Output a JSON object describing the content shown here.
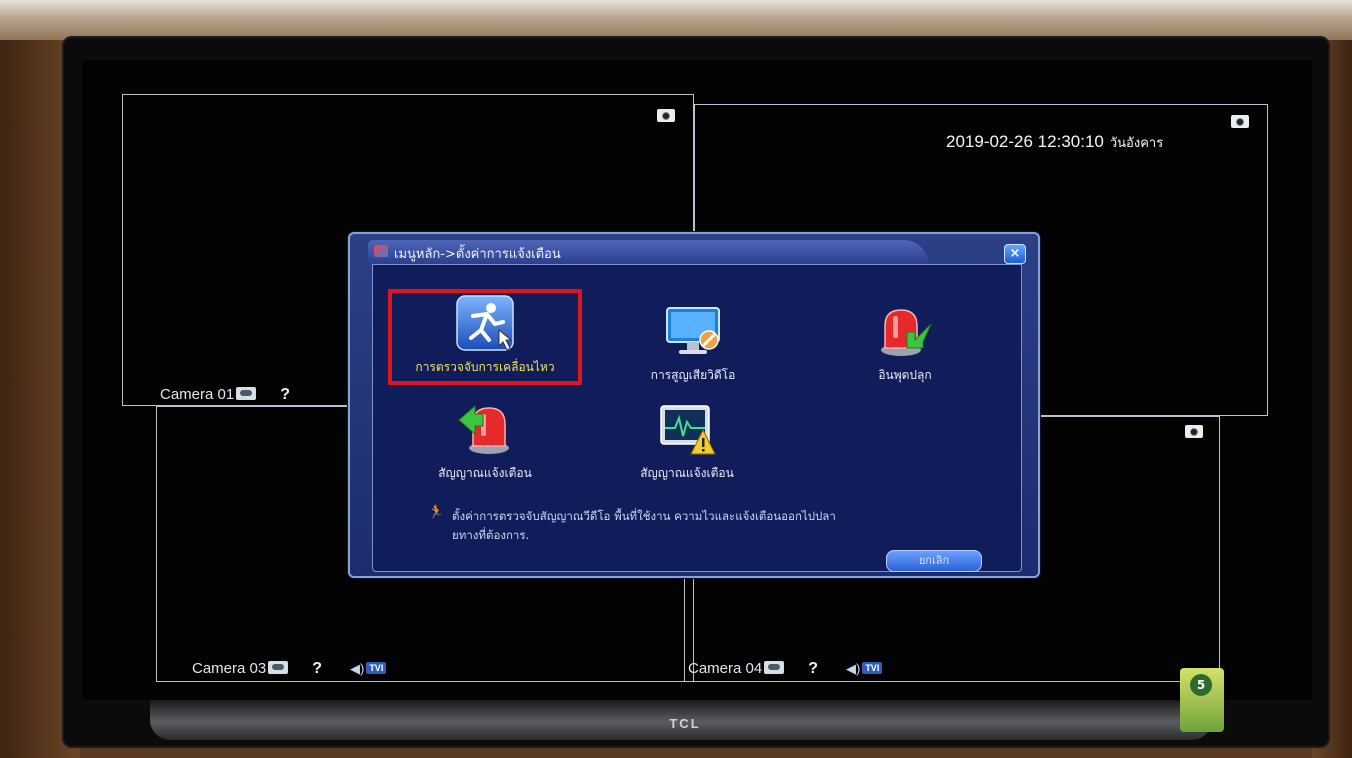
{
  "osd": {
    "datetime": "2019-02-26 12:30:10",
    "weekday": "วันอังคาร"
  },
  "cameras": [
    {
      "name": "Camera 01",
      "tvi": ""
    },
    {
      "name": "Camera 03",
      "tvi": "TVI"
    },
    {
      "name": "Camera 04",
      "tvi": "TVI"
    }
  ],
  "tv": {
    "brand": "TCL"
  },
  "dialog": {
    "title": "เมนูหลัก->ตั้งค่าการแจ้งเตือน",
    "close_label": "×",
    "tiles": [
      {
        "label": "การตรวจจับการเคลื่อนไหว",
        "icon": "motion-detect-icon",
        "selected": true
      },
      {
        "label": "การสูญเสียวิดีโอ",
        "icon": "video-loss-icon",
        "selected": false
      },
      {
        "label": "อินพุตปลุก",
        "icon": "alarm-input-icon",
        "selected": false
      },
      {
        "label": "สัญญาณแจ้งเตือน",
        "icon": "alarm-output-icon",
        "selected": false
      },
      {
        "label": "สัญญาณแจ้งเตือน",
        "icon": "abnormal-alarm-icon",
        "selected": false
      }
    ],
    "hint_line1": "ตั้งค่าการตรวจจับสัญญาณวีดีโอ พื้นที่ใช้งาน ความไวและแจ้งเตือนออกไปปลา",
    "hint_line2": "ยทางที่ต้องการ.",
    "ok_label": "ยกเลิก"
  },
  "colors": {
    "dialog_bg": "#1c2c6e",
    "highlight": "#e0141c",
    "screen_bg": "#030303"
  }
}
